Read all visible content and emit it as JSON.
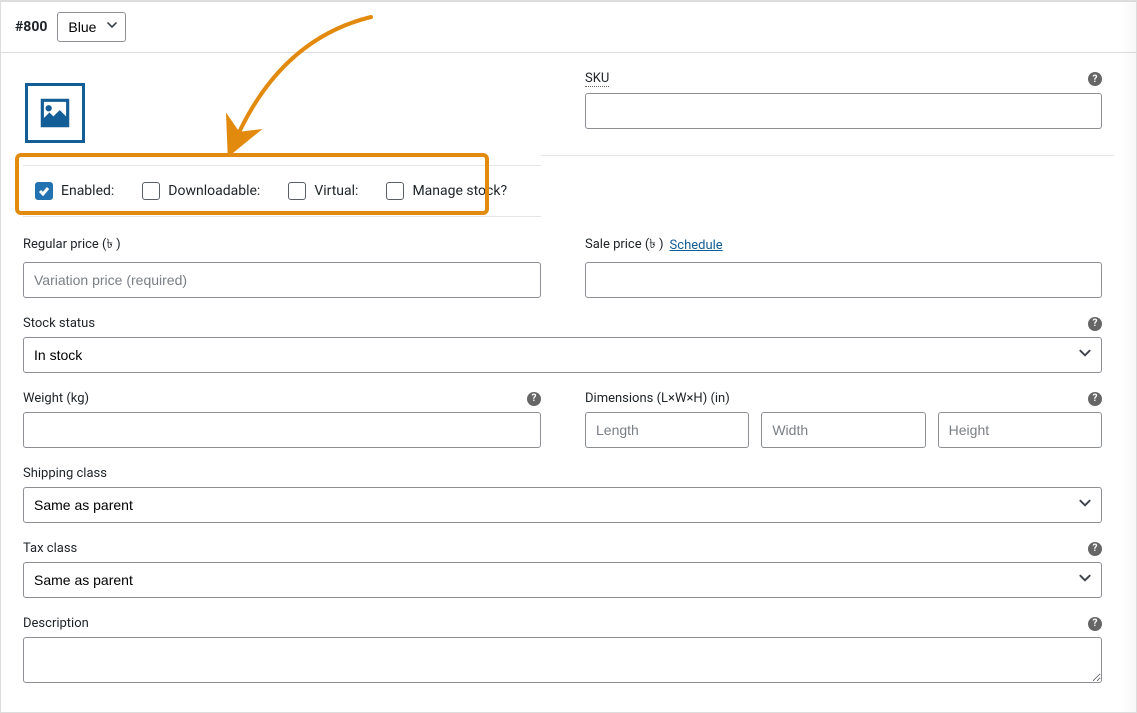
{
  "header": {
    "variation_id": "#800",
    "attribute_selected": "Blue"
  },
  "checkboxes": {
    "enabled_label": "Enabled:",
    "downloadable_label": "Downloadable:",
    "virtual_label": "Virtual:",
    "manage_stock_label": "Manage stock?"
  },
  "fields": {
    "sku_label": "SKU",
    "regular_price_label": "Regular price (৳ )",
    "regular_price_placeholder": "Variation price (required)",
    "sale_price_label": "Sale price (৳ )",
    "schedule_link": "Schedule",
    "stock_status_label": "Stock status",
    "stock_status_value": "In stock",
    "weight_label": "Weight (kg)",
    "dimensions_label": "Dimensions (L×W×H) (in)",
    "length_placeholder": "Length",
    "width_placeholder": "Width",
    "height_placeholder": "Height",
    "shipping_class_label": "Shipping class",
    "shipping_class_value": "Same as parent",
    "tax_class_label": "Tax class",
    "tax_class_value": "Same as parent",
    "description_label": "Description"
  },
  "annotation": {
    "highlight_color": "#e28a0e"
  }
}
